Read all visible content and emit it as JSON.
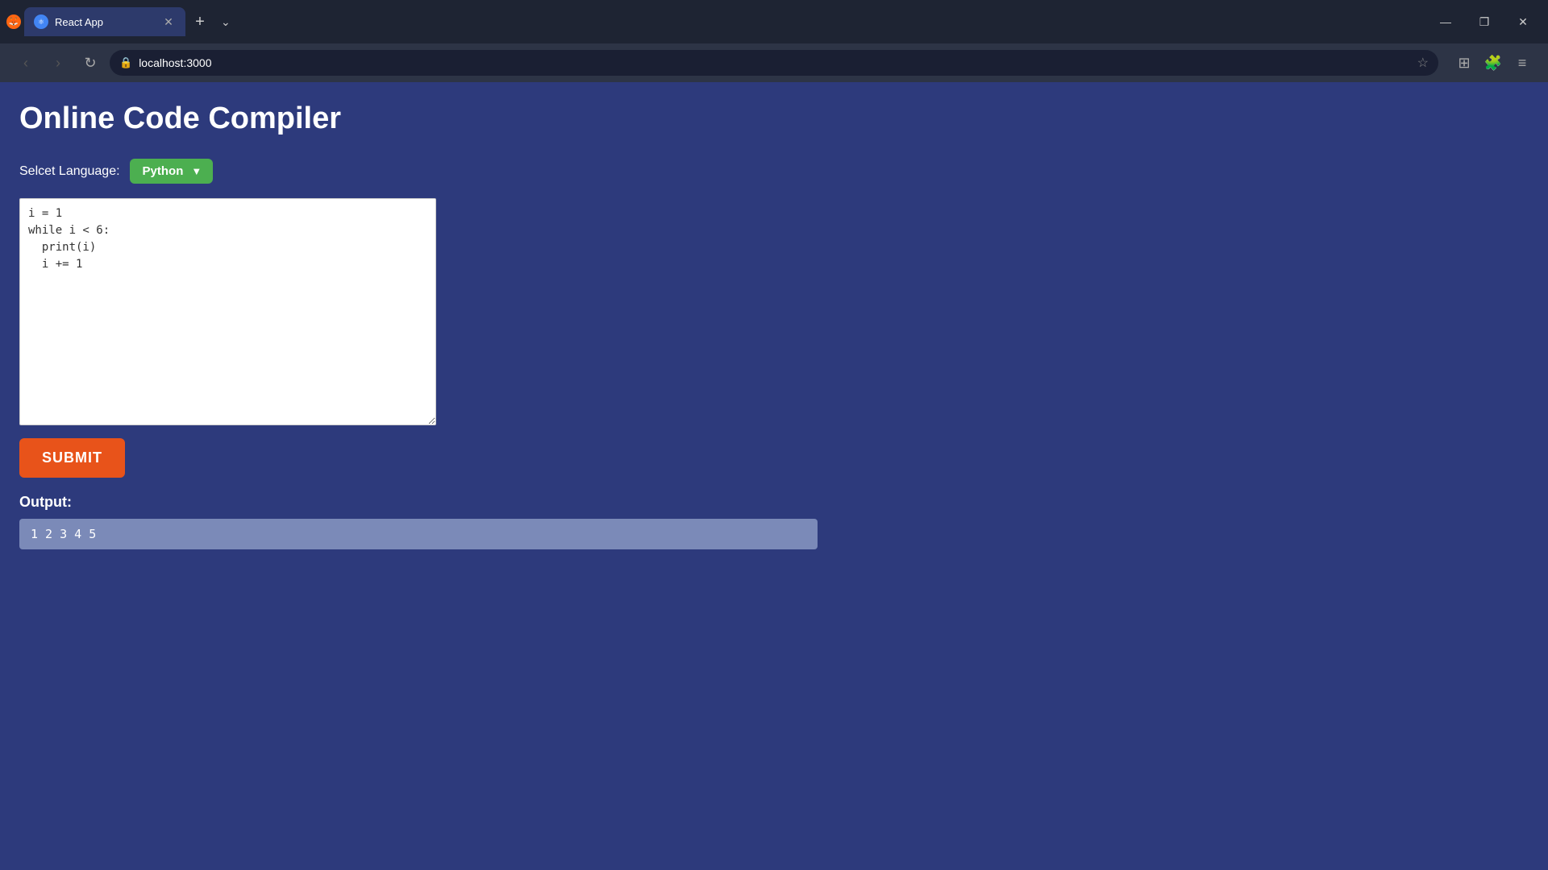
{
  "browser": {
    "tab_title": "React App",
    "new_tab_label": "+",
    "address": "localhost:3000",
    "dropdown_label": "⌄",
    "window_controls": {
      "minimize": "—",
      "maximize": "❐",
      "close": "✕"
    },
    "nav": {
      "back": "‹",
      "forward": "›",
      "refresh": "↻"
    }
  },
  "app": {
    "title": "Online Code Compiler",
    "language_label": "Selcet Language:",
    "language_value": "Python",
    "dropdown_arrow": "▼",
    "code_content": "i = 1\nwhile i < 6:\n  print(i)\n  i += 1",
    "submit_label": "SUBMIT",
    "output_label": "Output:",
    "output_value": "1 2 3 4 5"
  }
}
